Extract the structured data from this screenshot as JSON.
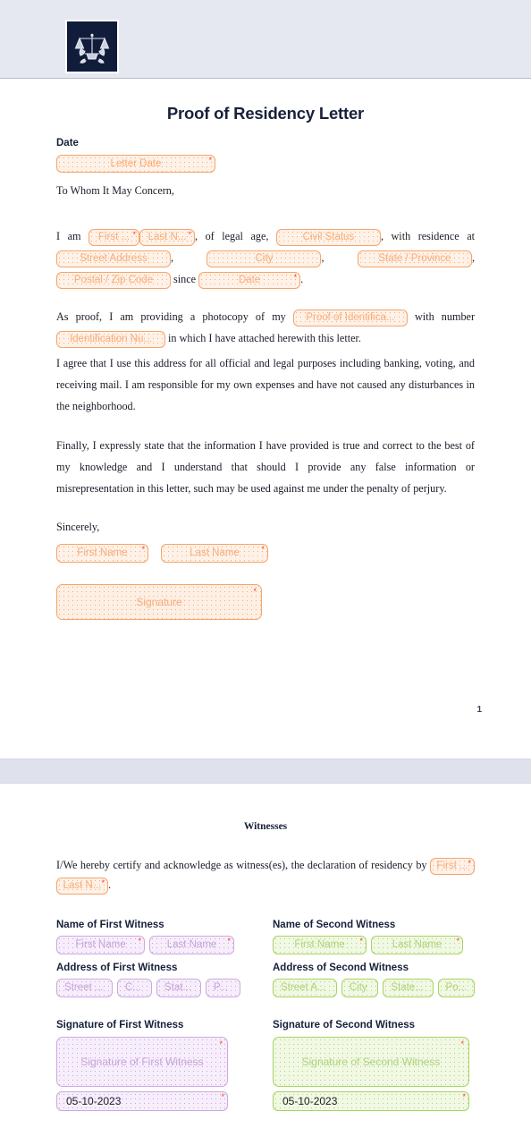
{
  "header": {
    "logo_alt": "scales-of-justice-logo"
  },
  "doc": {
    "title": "Proof of Residency Letter",
    "date_label": "Date",
    "salutation": "To Whom It May Concern,",
    "page_number": "1"
  },
  "fields": {
    "letter_date": "Letter Date",
    "first_name_short": "First ...",
    "last_name_short": "Last N...",
    "civil_status": "Civil Status",
    "street_address": "Street Address",
    "city": "City",
    "state_province": "State / Province",
    "postal_zip": "Postal / Zip Code",
    "since_date": "Date",
    "proof_of_id": "Proof of Identifica...",
    "id_number": "Identification Nu...",
    "first_name": "First Name",
    "last_name": "Last Name",
    "signature": "Signature",
    "required_mark": "*"
  },
  "paragraph1": {
    "t1": "I am",
    "t2": ", of legal age,",
    "t3": ", with residence at",
    "t4": ",",
    "t5": ",",
    "t6": ",",
    "t7": "since",
    "t8": "."
  },
  "paragraph2": {
    "t1": "As proof, I am providing a photocopy of my",
    "t2": "with number",
    "t3": "in which I have attached herewith this letter."
  },
  "paragraph3": "I agree that I use this address for all official and legal purposes including banking, voting, and receiving mail. I am responsible for my own expenses and have not caused any disturbances in the neighborhood.",
  "paragraph4": "Finally, I expressly state that the information I have provided is true and correct to the best of my knowledge and I understand that should I provide any false information or misrepresentation in this letter, such may be used against me under the penalty of perjury.",
  "closing": "Sincerely,",
  "witnesses": {
    "heading": "Witnesses",
    "intro": "I/We hereby certify and acknowledge as witness(es), the declaration of residency by",
    "intro_end": ".",
    "first": {
      "name_label": "Name of First Witness",
      "address_label": "Address of First Witness",
      "signature_label": "Signature of First Witness",
      "first_name": "First Name",
      "last_name": "Last Name",
      "street": "Street ...",
      "city": "C...",
      "state": "Stat...",
      "postal": "P...",
      "signature_placeholder": "Signature of First Witness",
      "date_value": "05-10-2023"
    },
    "second": {
      "name_label": "Name of Second Witness",
      "address_label": "Address of Second Witness",
      "signature_label": "Signature of Second Witness",
      "first_name": "First Name",
      "last_name": "Last Name",
      "street": "Street A...",
      "city": "City",
      "state": "State...",
      "postal": "Po...",
      "signature_placeholder": "Signature of Second Witness",
      "date_value": "05-10-2023"
    }
  },
  "colors": {
    "header_band": "#e5e8f0",
    "logo_bg": "#101c3a",
    "orange_border": "#f4a56b",
    "orange_fill": "#fef1e7",
    "orange_text": "#f7ac77",
    "purple_border": "#cda8e0",
    "purple_fill": "#f7eefb",
    "purple_text": "#c6a3d9",
    "green_border": "#a6d45f",
    "green_fill": "#f1f8e4",
    "green_text": "#aed377",
    "required_star": "#ff3b30",
    "title_text": "#18213b"
  }
}
